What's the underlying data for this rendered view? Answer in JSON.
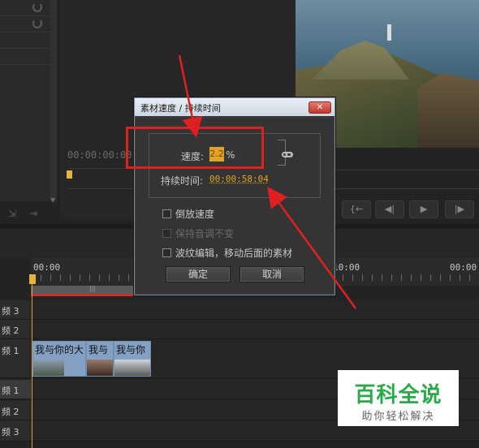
{
  "source_monitor": {
    "timecode": "00:00:00:00"
  },
  "program_monitor": {
    "subtitle": ""
  },
  "timeline": {
    "ruler_start": "00:00",
    "ruler_mid": "10:00",
    "ruler_end": "00:00",
    "tracks": [
      {
        "label": "频 3"
      },
      {
        "label": "频 2"
      },
      {
        "label": "频 1"
      },
      {
        "label": "频 1"
      },
      {
        "label": "频 2"
      },
      {
        "label": "频 3"
      }
    ],
    "clips": [
      {
        "label": "我与你的大"
      },
      {
        "label": "我与"
      },
      {
        "label": "我与你"
      }
    ]
  },
  "dialog": {
    "title": "素材速度 / 持续时间",
    "close_label": "✕",
    "speed_label": "速度:",
    "speed_value": "2.2",
    "speed_unit": "%",
    "duration_label": "持续时间:",
    "duration_value": "00:00:58:04",
    "reverse_label": "倒放速度",
    "reverse_checked": false,
    "keep_pitch_label": "保持音调不变",
    "keep_pitch_checked": false,
    "ripple_label": "波纹编辑，移动后面的素材",
    "ripple_checked": false,
    "ok_label": "确定",
    "cancel_label": "取消"
  },
  "controls": {
    "buttons": [
      "{←",
      "◀|",
      "▶",
      "|▶"
    ]
  },
  "watermark": {
    "title": "百科全说",
    "subtitle": "助你轻松解决"
  },
  "colors": {
    "accent": "#e0a325",
    "annotation": "#e02020",
    "watermark_green": "#2aa84a"
  }
}
